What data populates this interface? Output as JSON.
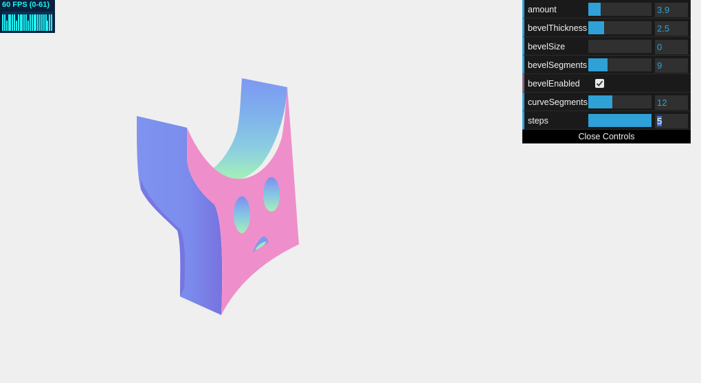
{
  "fps": {
    "label": "60 FPS (0-61)",
    "bars": [
      0.85,
      0.85,
      0.55,
      0.85,
      0.85,
      0.85,
      0.85,
      0.55,
      0.85,
      0.85,
      0.85,
      0.85,
      0.85,
      0.55,
      0.85,
      0.85,
      0.85,
      0.85,
      0.85,
      0.85,
      0.85,
      0.85,
      0.85,
      0.55,
      0.85,
      0.85
    ]
  },
  "scene": {
    "object_name": "extruded-shape",
    "colors": {
      "background": "#efefef",
      "front_face": "#ee8fcb",
      "side_blue": "#7a8ff0",
      "side_violet": "#7c78e2",
      "inner_teal": "#8fd7d8",
      "inner_green": "#a5f1b8"
    }
  },
  "controls": {
    "rows": [
      {
        "label": "amount",
        "value": "3.9",
        "fill": 0.2,
        "type": "number"
      },
      {
        "label": "bevelThickness",
        "value": "2.5",
        "fill": 0.25,
        "type": "number"
      },
      {
        "label": "bevelSize",
        "value": "0",
        "fill": 0.0,
        "type": "number"
      },
      {
        "label": "bevelSegments",
        "value": "9",
        "fill": 0.3,
        "type": "number"
      },
      {
        "label": "bevelEnabled",
        "checked": true,
        "type": "boolean"
      },
      {
        "label": "curveSegments",
        "value": "12",
        "fill": 0.38,
        "type": "number"
      },
      {
        "label": "steps",
        "value": "5",
        "fill": 1.0,
        "type": "number"
      }
    ],
    "close_label": "Close Controls",
    "accent": "#2fa1d6"
  }
}
